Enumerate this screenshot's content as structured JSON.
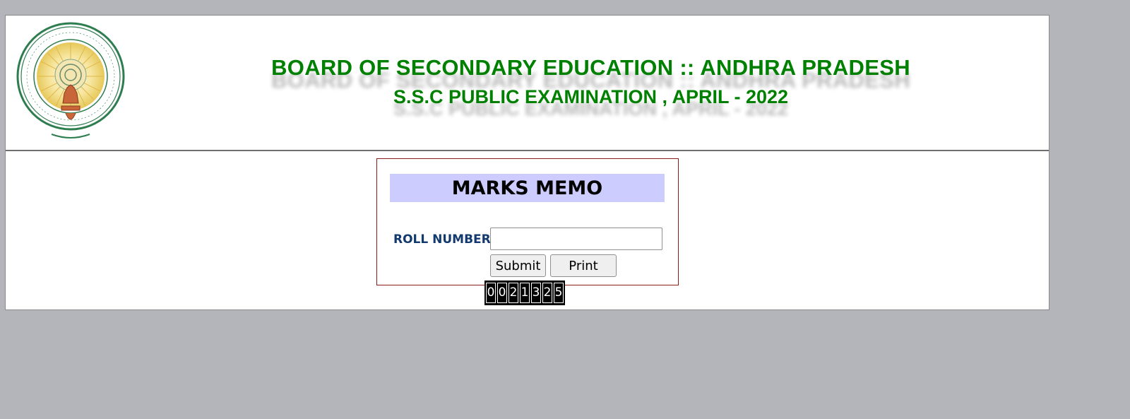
{
  "header": {
    "title": "BOARD OF SECONDARY EDUCATION :: ANDHRA PRADESH",
    "subtitle": "S.S.C PUBLIC EXAMINATION , APRIL - 2022",
    "emblem_icon": "andhra-pradesh-emblem-icon"
  },
  "form": {
    "heading": "MARKS MEMO",
    "roll_label": "ROLL NUMBER",
    "roll_value": "",
    "submit_label": "Submit",
    "print_label": "Print"
  },
  "counter": {
    "digits": [
      "0",
      "0",
      "2",
      "1",
      "3",
      "2",
      "5"
    ]
  },
  "colors": {
    "title_green": "#008000",
    "memo_bg": "#ccccff",
    "label_blue": "#123a6e",
    "box_border": "#8b1a1a",
    "page_bg": "#b4b5ba"
  }
}
